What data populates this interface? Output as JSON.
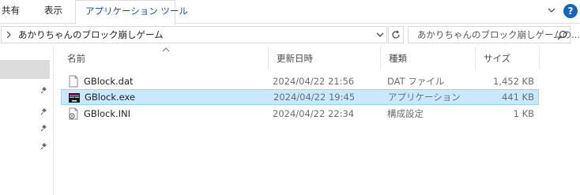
{
  "ribbon": {
    "tabs": [
      "共有",
      "表示",
      "アプリケーション ツール"
    ],
    "help_label": "?"
  },
  "address": {
    "path": "あかりちゃんのブロック崩しゲーム",
    "search_placeholder": "あかりちゃんのブロック崩しゲームの..."
  },
  "columns": {
    "name": "名前",
    "date": "更新日時",
    "type": "種類",
    "size": "サイズ"
  },
  "files": [
    {
      "name": "GBlock.dat",
      "date": "2024/04/22 21:56",
      "type": "DAT ファイル",
      "size": "1,452 KB",
      "icon": "file-icon",
      "selected": false
    },
    {
      "name": "GBlock.exe",
      "date": "2024/04/22 19:45",
      "type": "アプリケーション",
      "size": "441 KB",
      "icon": "application-icon",
      "selected": true
    },
    {
      "name": "GBlock.INI",
      "date": "2024/04/22 22:34",
      "type": "構成設定",
      "size": "1 KB",
      "icon": "settings-file-icon",
      "selected": false
    }
  ],
  "colors": {
    "selection_bg": "#cce8ff",
    "selection_border": "#99d1ff",
    "active_tab_text": "#1a4d9a",
    "help_blue": "#1565c0"
  }
}
